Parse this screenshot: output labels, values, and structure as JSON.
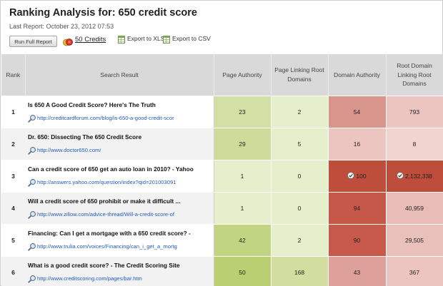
{
  "header": {
    "title": "Ranking Analysis for: 650 credit score",
    "last_report": "Last Report: October 23, 2012 07:53"
  },
  "toolbar": {
    "run_label": "Run Full Report",
    "credits_label": "50 Credits",
    "export_xls_label": "Export to XLS",
    "export_csv_label": "Export to CSV"
  },
  "table": {
    "columns": [
      "Rank",
      "Search Result",
      "Page Authority",
      "Page Linking Root Domains",
      "Domain Authority",
      "Root Domain Linking Root Domains"
    ],
    "rows": [
      {
        "rank": "1",
        "title": "Is 650 A Good Credit Score? Here's The Truth",
        "url": "http://creditcardforum.com/blog/is-650-a-good-credit-scor",
        "pa": "23",
        "plrd": "2",
        "da": "54",
        "rdlrd": "793",
        "pa_color": "#d3e0a5",
        "plrd_color": "#e5efcb",
        "da_color": "#d8958c",
        "rdlrd_color": "#ecc5c1",
        "da_check": false,
        "rdlrd_check": false
      },
      {
        "rank": "2",
        "title": "Dr. 650: Dissecting The 650 Credit Score",
        "url": "http://www.doctor650.com/",
        "pa": "29",
        "plrd": "5",
        "da": "16",
        "rdlrd": "8",
        "pa_color": "#cedc9b",
        "plrd_color": "#e5efcb",
        "da_color": "#ecc5c1",
        "rdlrd_color": "#f1d3d0",
        "da_check": false,
        "rdlrd_check": false
      },
      {
        "rank": "3",
        "title": "Can a credit score of 650 get an auto loan in 2010? - Yahoo",
        "url": "http://answers.yahoo.com/question/index?qid=201003091",
        "pa": "1",
        "plrd": "0",
        "da": "100",
        "rdlrd": "2,132,338",
        "pa_color": "#e5efcb",
        "plrd_color": "#e5efcb",
        "da_color": "#bf4d3c",
        "rdlrd_color": "#bf4d3c",
        "da_check": true,
        "rdlrd_check": true
      },
      {
        "rank": "4",
        "title": "Will a credit score of 650 prohibit or make it difficult ...",
        "url": "http://www.zillow.com/advice-thread/Will-a-credit-score-of",
        "pa": "1",
        "plrd": "0",
        "da": "94",
        "rdlrd": "40,959",
        "pa_color": "#e5efcb",
        "plrd_color": "#e5efcb",
        "da_color": "#c6584a",
        "rdlrd_color": "#e8bcb7",
        "da_check": false,
        "rdlrd_check": false
      },
      {
        "rank": "5",
        "title": "Financing: Can I get a mortgage with a 650 credit score? -",
        "url": "http://www.trulia.com/voices/Financing/can_i_get_a_mortg",
        "pa": "42",
        "plrd": "2",
        "da": "90",
        "rdlrd": "29,505",
        "pa_color": "#c1d482",
        "plrd_color": "#e5efcb",
        "da_color": "#c7594b",
        "rdlrd_color": "#eac0bb",
        "da_check": false,
        "rdlrd_check": false
      },
      {
        "rank": "6",
        "title": "What is a good credit score? - The Credit Scoring Site",
        "url": "http://www.creditscoring.com/pages/bar.htm",
        "pa": "50",
        "plrd": "168",
        "da": "43",
        "rdlrd": "367",
        "pa_color": "#b9cf72",
        "plrd_color": "#d1de9f",
        "da_color": "#dea09a",
        "rdlrd_color": "#ecc5c1",
        "da_check": false,
        "rdlrd_check": false
      }
    ]
  },
  "icons": {
    "credits": "coins-icon",
    "export_xls": "spreadsheet-icon",
    "export_csv": "spreadsheet-icon",
    "url": "magnifier-icon",
    "max_value": "check-circle-icon"
  }
}
